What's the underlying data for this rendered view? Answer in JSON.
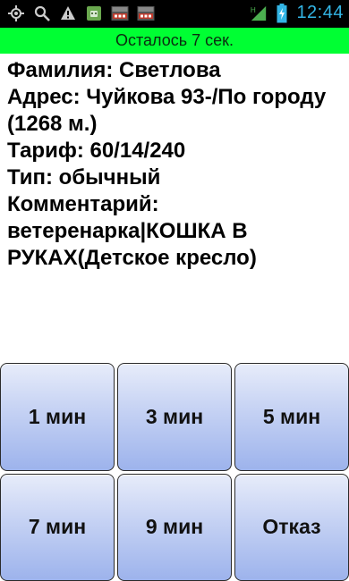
{
  "status_bar": {
    "icons_left": [
      "gps-icon",
      "search-icon",
      "warning-icon",
      "android-icon",
      "taximeter-icon",
      "taximeter-icon"
    ],
    "icons_right": [
      "signal-icon",
      "battery-icon"
    ],
    "clock": "12:44",
    "accent": "#33b5e5"
  },
  "timer": {
    "text": "Осталось 7 сек.",
    "color": "#00ff33"
  },
  "order": {
    "lines": [
      "Фамилия: Светлова",
      "Адрес: Чуйкова 93-/По городу",
      "(1268 м.)",
      "Тариф: 60/14/240",
      "Тип: обычный",
      "Комментарий:",
      "ветеренарка|КОШКА В",
      "РУКАХ(Детское кресло)"
    ]
  },
  "buttons": [
    "1 мин",
    "3 мин",
    "5 мин",
    "7 мин",
    "9 мин",
    "Отказ"
  ]
}
